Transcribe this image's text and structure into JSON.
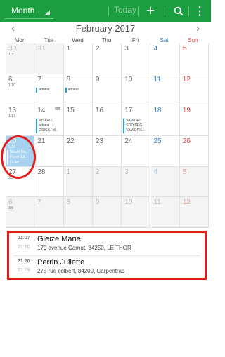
{
  "toolbar": {
    "view_label": "Month",
    "today_label": "Today",
    "add_icon": "plus-icon",
    "search_icon": "search-icon",
    "more_icon": "more-vertical-icon",
    "bar_color": "#1a9e3f"
  },
  "month": {
    "title": "February 2017",
    "prev": "‹",
    "next": "›"
  },
  "weekdays": [
    "Mon",
    "Tue",
    "Wed",
    "Thu",
    "Fri",
    "Sat",
    "Sun"
  ],
  "weeks": [
    {
      "days": [
        {
          "d": "30",
          "sub": "1/3"
        },
        {
          "d": "31"
        },
        {
          "d": "1"
        },
        {
          "d": "2"
        },
        {
          "d": "3"
        },
        {
          "d": "4"
        },
        {
          "d": "5"
        }
      ]
    },
    {
      "days": [
        {
          "d": "6",
          "sub": "1/10"
        },
        {
          "d": "7",
          "events": [
            "adonai"
          ]
        },
        {
          "d": "8",
          "events": [
            "adonai"
          ]
        },
        {
          "d": "9"
        },
        {
          "d": "10"
        },
        {
          "d": "11"
        },
        {
          "d": "12"
        }
      ]
    },
    {
      "days": [
        {
          "d": "13",
          "sub": "1/17"
        },
        {
          "d": "14",
          "events": [
            "VISAVI /..",
            "adonai",
            "OSICA / M.."
          ]
        },
        {
          "d": "15"
        },
        {
          "d": "16"
        },
        {
          "d": "17",
          "events": [
            "VAM DRIL..",
            "SODINEG",
            "VAM DRIL.."
          ]
        },
        {
          "d": "18"
        },
        {
          "d": "19"
        }
      ]
    },
    {
      "days": [
        {
          "d": "20",
          "sub": "1/24",
          "events": [
            "Gleize Ma..",
            "Perrin Jul..",
            "e.i.lue"
          ]
        },
        {
          "d": "21"
        },
        {
          "d": "22"
        },
        {
          "d": "23"
        },
        {
          "d": "24"
        },
        {
          "d": "25"
        },
        {
          "d": "26"
        }
      ]
    },
    {
      "days": [
        {
          "d": "27",
          "sub": "2/2"
        },
        {
          "d": "28"
        },
        {
          "d": "1"
        },
        {
          "d": "2"
        },
        {
          "d": "3"
        },
        {
          "d": "4"
        },
        {
          "d": "5"
        }
      ]
    },
    {
      "days": [
        {
          "d": "6",
          "sub": "3/9"
        },
        {
          "d": "7"
        },
        {
          "d": "8"
        },
        {
          "d": "9"
        },
        {
          "d": "10"
        },
        {
          "d": "11"
        },
        {
          "d": "12"
        }
      ]
    }
  ],
  "events_list": [
    {
      "start": "21:07",
      "end": "21:10",
      "title": "Gleize Marie",
      "location": "179 avenue Carnot, 84250, LE THOR"
    },
    {
      "start": "21:26",
      "end": "21:29",
      "title": "Perrin Juliette",
      "location": "275 rue colbert, 84200, Carpentras"
    }
  ]
}
